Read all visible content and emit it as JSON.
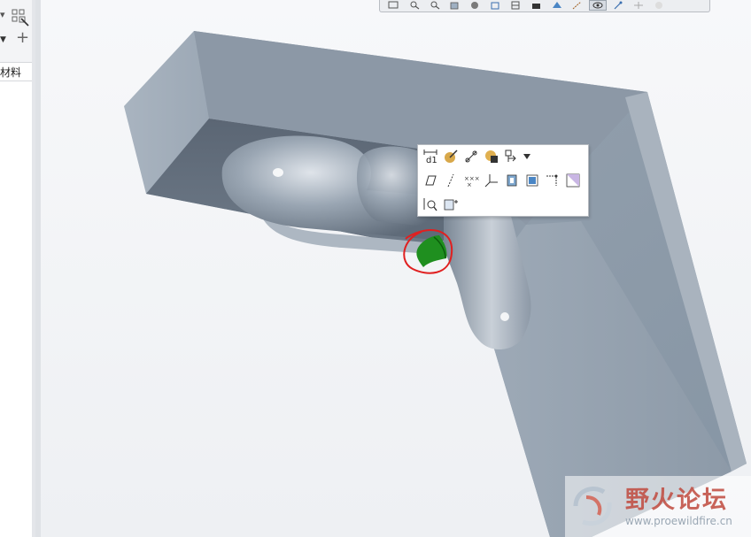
{
  "model_tree": {
    "tree_item_label": "材料"
  },
  "view_toolbar": {
    "buttons": [
      "refit-icon",
      "zoom-in-icon",
      "zoom-out-icon",
      "repaint-icon",
      "display-style-icon",
      "saved-orientations-icon",
      "view-manager-icon",
      "perspective-icon",
      "section-icon",
      "datum-display-icon",
      "annotation-display-icon",
      "spin-center-icon",
      "display-filter-icon"
    ]
  },
  "mini_toolbar": {
    "row1": [
      "edit-dimensions-icon",
      "edit-appearance-icon",
      "round-chain-icon",
      "appearance-icon",
      "select-filter-icon"
    ],
    "row2": [
      "plane-icon",
      "axis-icon",
      "point-icon",
      "coordinate-system-icon",
      "body-icon",
      "surface-icon",
      "sketch-icon",
      "analysis-icon"
    ],
    "row3": [
      "inspect-icon",
      "new-view-icon"
    ]
  },
  "watermark": {
    "title": "野火论坛",
    "url": "www.proewildfire.cn"
  },
  "colors": {
    "model_top": "#8e9aa7",
    "model_side_light": "#a8b3bf",
    "model_side_dark": "#5d6977",
    "highlight_green": "#1f8f1f",
    "annotation_red": "#e02020"
  }
}
